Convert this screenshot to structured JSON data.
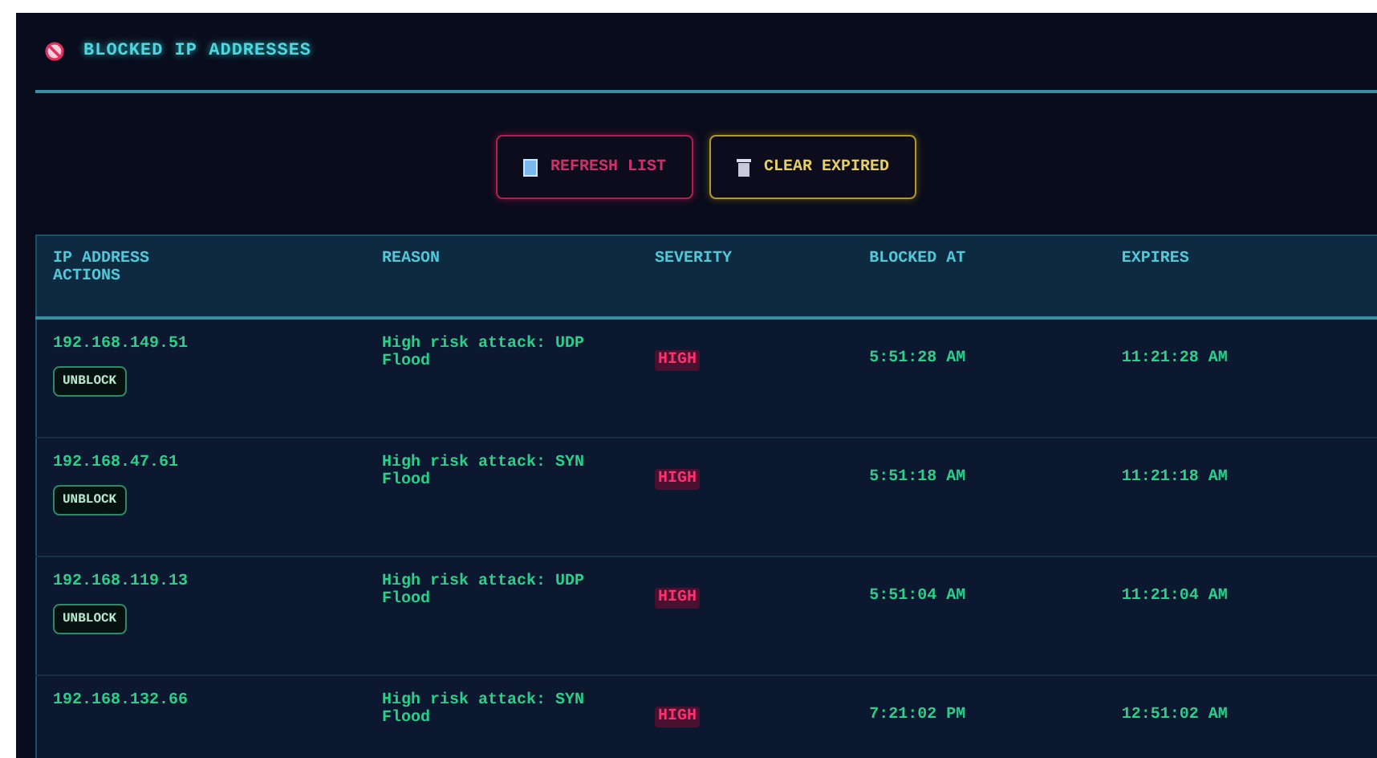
{
  "panel": {
    "title": "BLOCKED IP ADDRESSES"
  },
  "buttons": [
    {
      "kind": "refresh",
      "label": "REFRESH LIST"
    },
    {
      "kind": "clear",
      "label": "CLEAR EXPIRED"
    }
  ],
  "table": {
    "columns": [
      "IP ADDRESS\nACTIONS",
      "REASON",
      "SEVERITY",
      "BLOCKED AT",
      "EXPIRES"
    ],
    "rows": [
      {
        "ip": "192.168.149.51",
        "action": "UNBLOCK",
        "reason": "High risk attack: UDP Flood",
        "severity": "HIGH",
        "blocked_at": "5:51:28 AM",
        "expires": "11:21:28 AM"
      },
      {
        "ip": "192.168.47.61",
        "action": "UNBLOCK",
        "reason": "High risk attack: SYN Flood",
        "severity": "HIGH",
        "blocked_at": "5:51:18 AM",
        "expires": "11:21:18 AM"
      },
      {
        "ip": "192.168.119.13",
        "action": "UNBLOCK",
        "reason": "High risk attack: UDP Flood",
        "severity": "HIGH",
        "blocked_at": "5:51:04 AM",
        "expires": "11:21:04 AM"
      },
      {
        "ip": "192.168.132.66",
        "reason": "High risk attack: SYN Flood",
        "severity": "HIGH",
        "blocked_at": "7:21:02 PM",
        "expires": "12:51:02 AM"
      }
    ]
  }
}
